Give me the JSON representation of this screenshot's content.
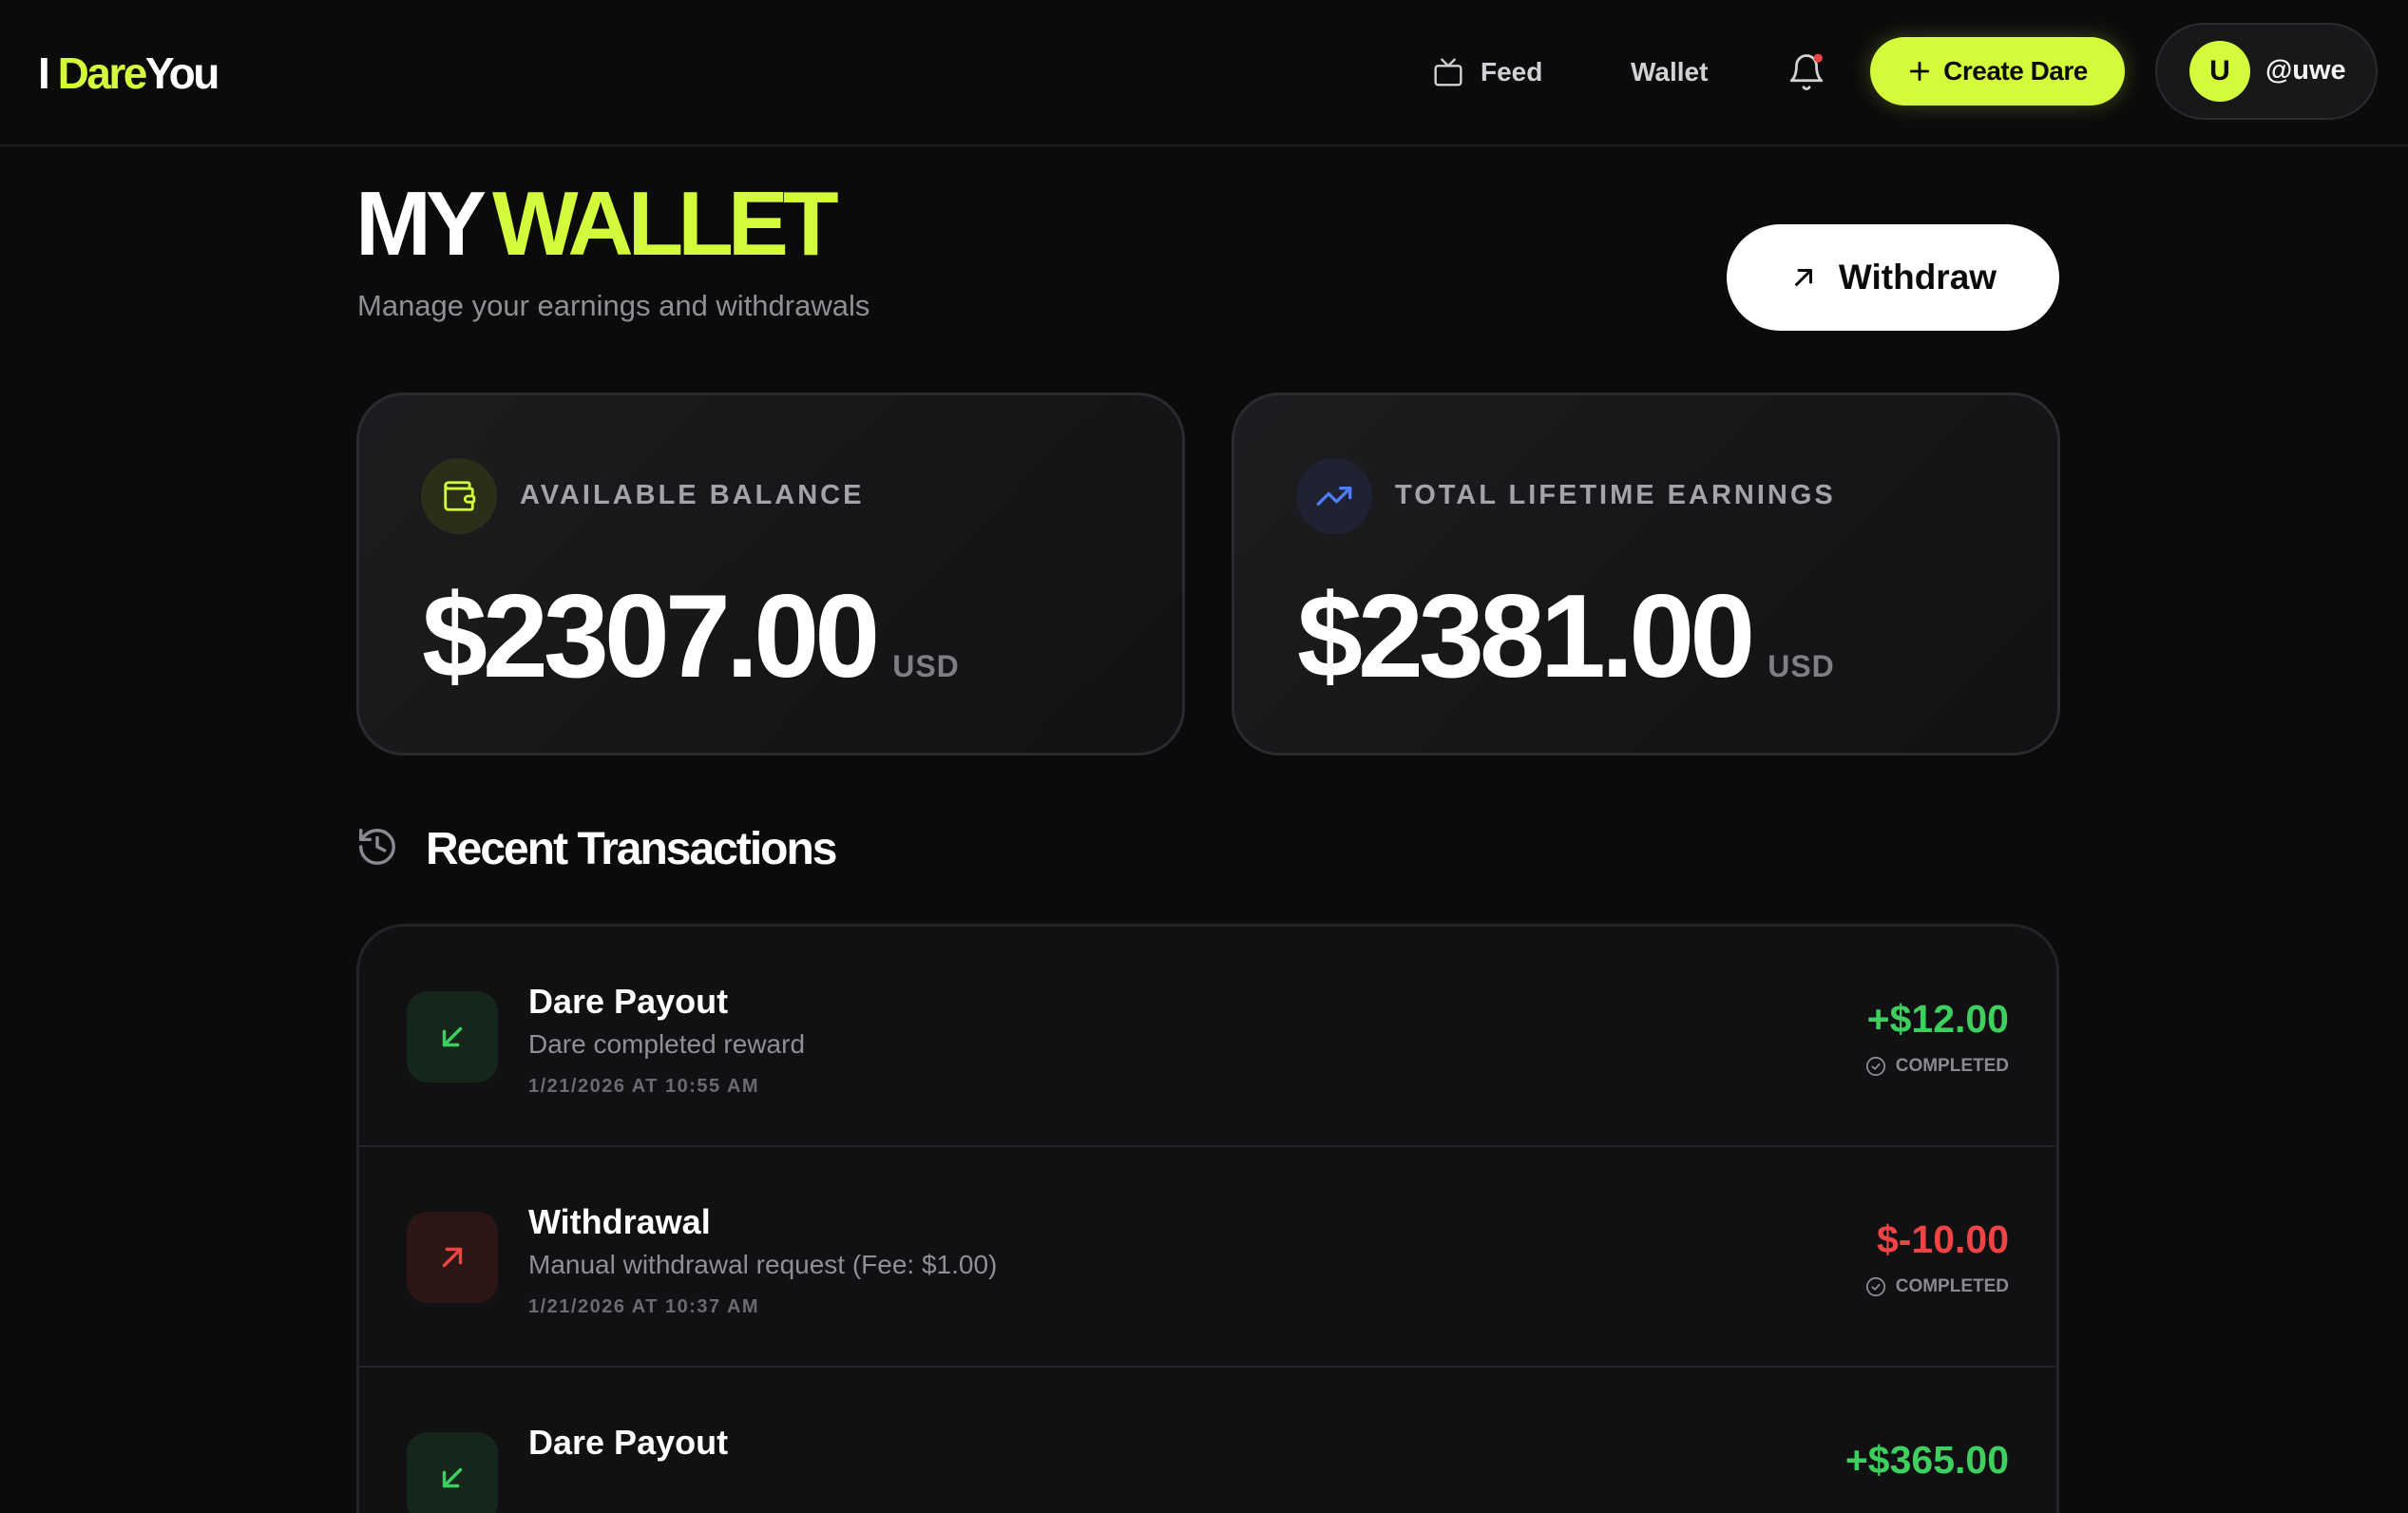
{
  "header": {
    "logo": {
      "prefix": "I",
      "accent": "Dare",
      "suffix": "You"
    },
    "nav": {
      "feed": "Feed",
      "wallet": "Wallet"
    },
    "create_button": "Create Dare",
    "user": {
      "initial": "U",
      "handle": "@uwe"
    }
  },
  "page": {
    "title_plain": "MY",
    "title_accent": "WALLET",
    "subtitle": "Manage your earnings and withdrawals",
    "withdraw_button": "Withdraw"
  },
  "cards": {
    "balance": {
      "label": "AVAILABLE BALANCE",
      "amount": "$2307.00",
      "unit": "USD"
    },
    "earnings": {
      "label": "TOTAL LIFETIME EARNINGS",
      "amount": "$2381.00",
      "unit": "USD"
    }
  },
  "transactions": {
    "title": "Recent Transactions",
    "items": [
      {
        "title": "Dare Payout",
        "description": "Dare completed reward",
        "date": "1/21/2026 AT 10:55 AM",
        "amount": "+$12.00",
        "status": "COMPLETED"
      },
      {
        "title": "Withdrawal",
        "description": "Manual withdrawal request (Fee: $1.00)",
        "date": "1/21/2026 AT 10:37 AM",
        "amount": "$-10.00",
        "status": "COMPLETED"
      },
      {
        "title": "Dare Payout",
        "amount": "+$365.00"
      }
    ]
  },
  "colors": {
    "accent": "#d4fa3c",
    "background": "#0b0b0c",
    "income": "#3fcf5f",
    "expense": "#ef4444",
    "notification_dot": "#ef4444"
  },
  "icons": {
    "feed": "tv-icon",
    "notifications": "bell-icon",
    "create": "plus-icon",
    "withdraw": "arrow-up-right-icon",
    "balance": "wallet-icon",
    "earnings": "trending-up-icon",
    "history": "history-icon",
    "incoming": "arrow-down-left-icon",
    "outgoing": "arrow-up-right-icon",
    "status": "check-circle-icon"
  }
}
